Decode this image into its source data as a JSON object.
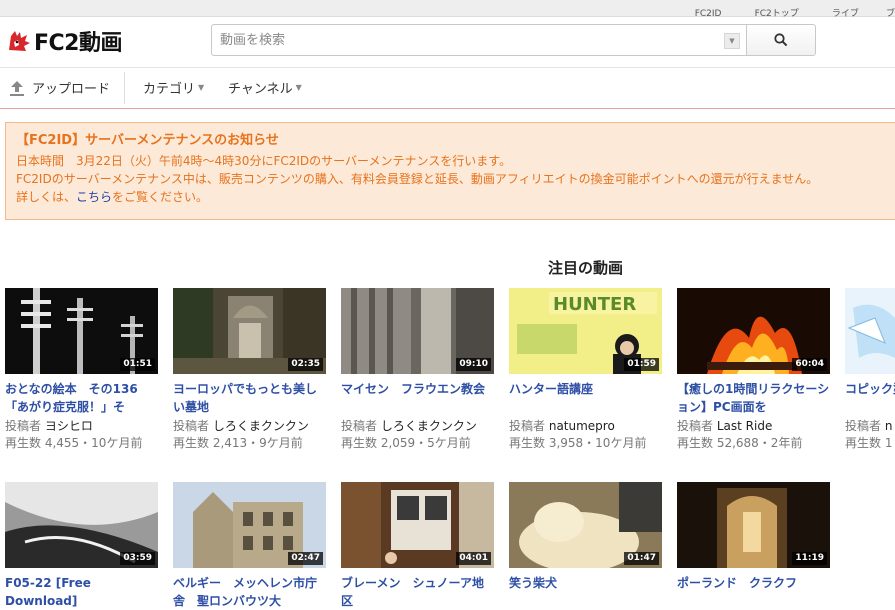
{
  "top_links": [
    "FC2ID",
    "FC2トップ",
    "ライブ",
    "ブ"
  ],
  "header": {
    "logo_text": "FC2動画",
    "search_placeholder": "動画を検索"
  },
  "nav": {
    "upload": "アップロード",
    "category": "カテゴリ",
    "channel": "チャンネル"
  },
  "notice": {
    "title": "【FC2ID】サーバーメンテナンスのお知らせ",
    "line1": "日本時間　3月22日（火）午前4時〜4時30分にFC2IDのサーバーメンテナンスを行います。",
    "line2": "FC2IDのサーバーメンテナンス中は、販売コンテンツの購入、有料会員登録と延長、動画アフィリエイトの換金可能ポイントへの還元が行えません。",
    "line3_prefix": "詳しくは、",
    "line3_link": "こちら",
    "line3_suffix": "をご覧ください。"
  },
  "section_title": "注目の動画",
  "poster_label": "投稿者",
  "videos_row1": [
    {
      "title": "おとなの絵本　その136「あがり症克服！」そ",
      "duration": "01:51",
      "poster": "ヨシヒロ",
      "stats": "再生数 4,455・10ケ月前"
    },
    {
      "title": "ヨーロッパでもっとも美しい墓地",
      "duration": "02:35",
      "poster": "しろくまクンクン",
      "stats": "再生数 2,413・9ケ月前"
    },
    {
      "title": "マイセン　フラウエン教会",
      "duration": "09:10",
      "poster": "しろくまクンクン",
      "stats": "再生数 2,059・5ケ月前"
    },
    {
      "title": "ハンター語講座",
      "duration": "01:59",
      "poster": "natumepro",
      "stats": "再生数 3,958・10ケ月前"
    },
    {
      "title": "【癒しの1時間リラクセーション】PC画面を",
      "duration": "60:04",
      "poster": "Last Ride",
      "stats": "再生数 52,688・2年前"
    },
    {
      "title": "コピック塗",
      "duration": "",
      "poster": "n",
      "stats": "再生数 1"
    }
  ],
  "videos_row2": [
    {
      "title": "F05-22 [Free Download]",
      "duration": "03:59"
    },
    {
      "title": "ベルギー　メッヘレン市庁舎　聖ロンバウツ大",
      "duration": "02:47"
    },
    {
      "title": "ブレーメン　シュノーア地区",
      "duration": "04:01"
    },
    {
      "title": "笑う柴犬",
      "duration": "01:47"
    },
    {
      "title": "ポーランド　クラクフ",
      "duration": "11:19"
    }
  ],
  "colors": {
    "accent_link": "#2e4fa6",
    "notice_text": "#e6731d",
    "notice_bg": "#fde9d8",
    "nav_border": "#e8a0a0"
  }
}
